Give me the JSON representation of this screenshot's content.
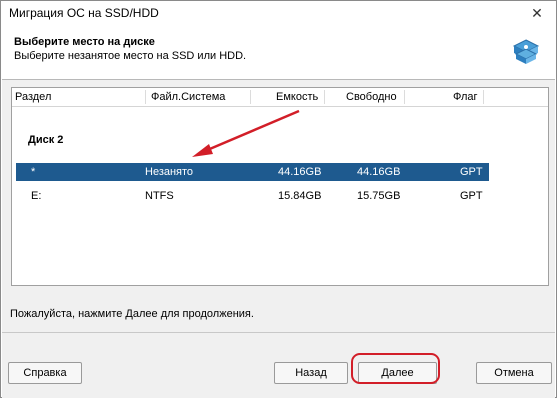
{
  "window": {
    "title": "Миграция ОС на SSD/HDD",
    "close_glyph": "✕"
  },
  "header": {
    "title": "Выберите место на диске",
    "subtitle": "Выберите незанятое место на SSD или HDD.",
    "icon": "disk-migration-icon"
  },
  "table": {
    "columns": [
      "Раздел",
      "Файл.Система",
      "Емкость",
      "Свободно",
      "Флаг"
    ],
    "disk_label": "Диск 2",
    "rows": [
      {
        "partition": "*",
        "fs": "Незанято",
        "capacity": "44.16GB",
        "free": "44.16GB",
        "flag": "GPT",
        "selected": true
      },
      {
        "partition": "E:",
        "fs": "NTFS",
        "capacity": "15.84GB",
        "free": "15.75GB",
        "flag": "GPT",
        "selected": false
      }
    ]
  },
  "hint": "Пожалуйста, нажмите Далее для продолжения.",
  "buttons": {
    "help": "Справка",
    "back": "Назад",
    "next": "Далее",
    "cancel": "Отмена"
  },
  "colors": {
    "selection": "#1e5a8f",
    "annotation": "#d21e28"
  }
}
